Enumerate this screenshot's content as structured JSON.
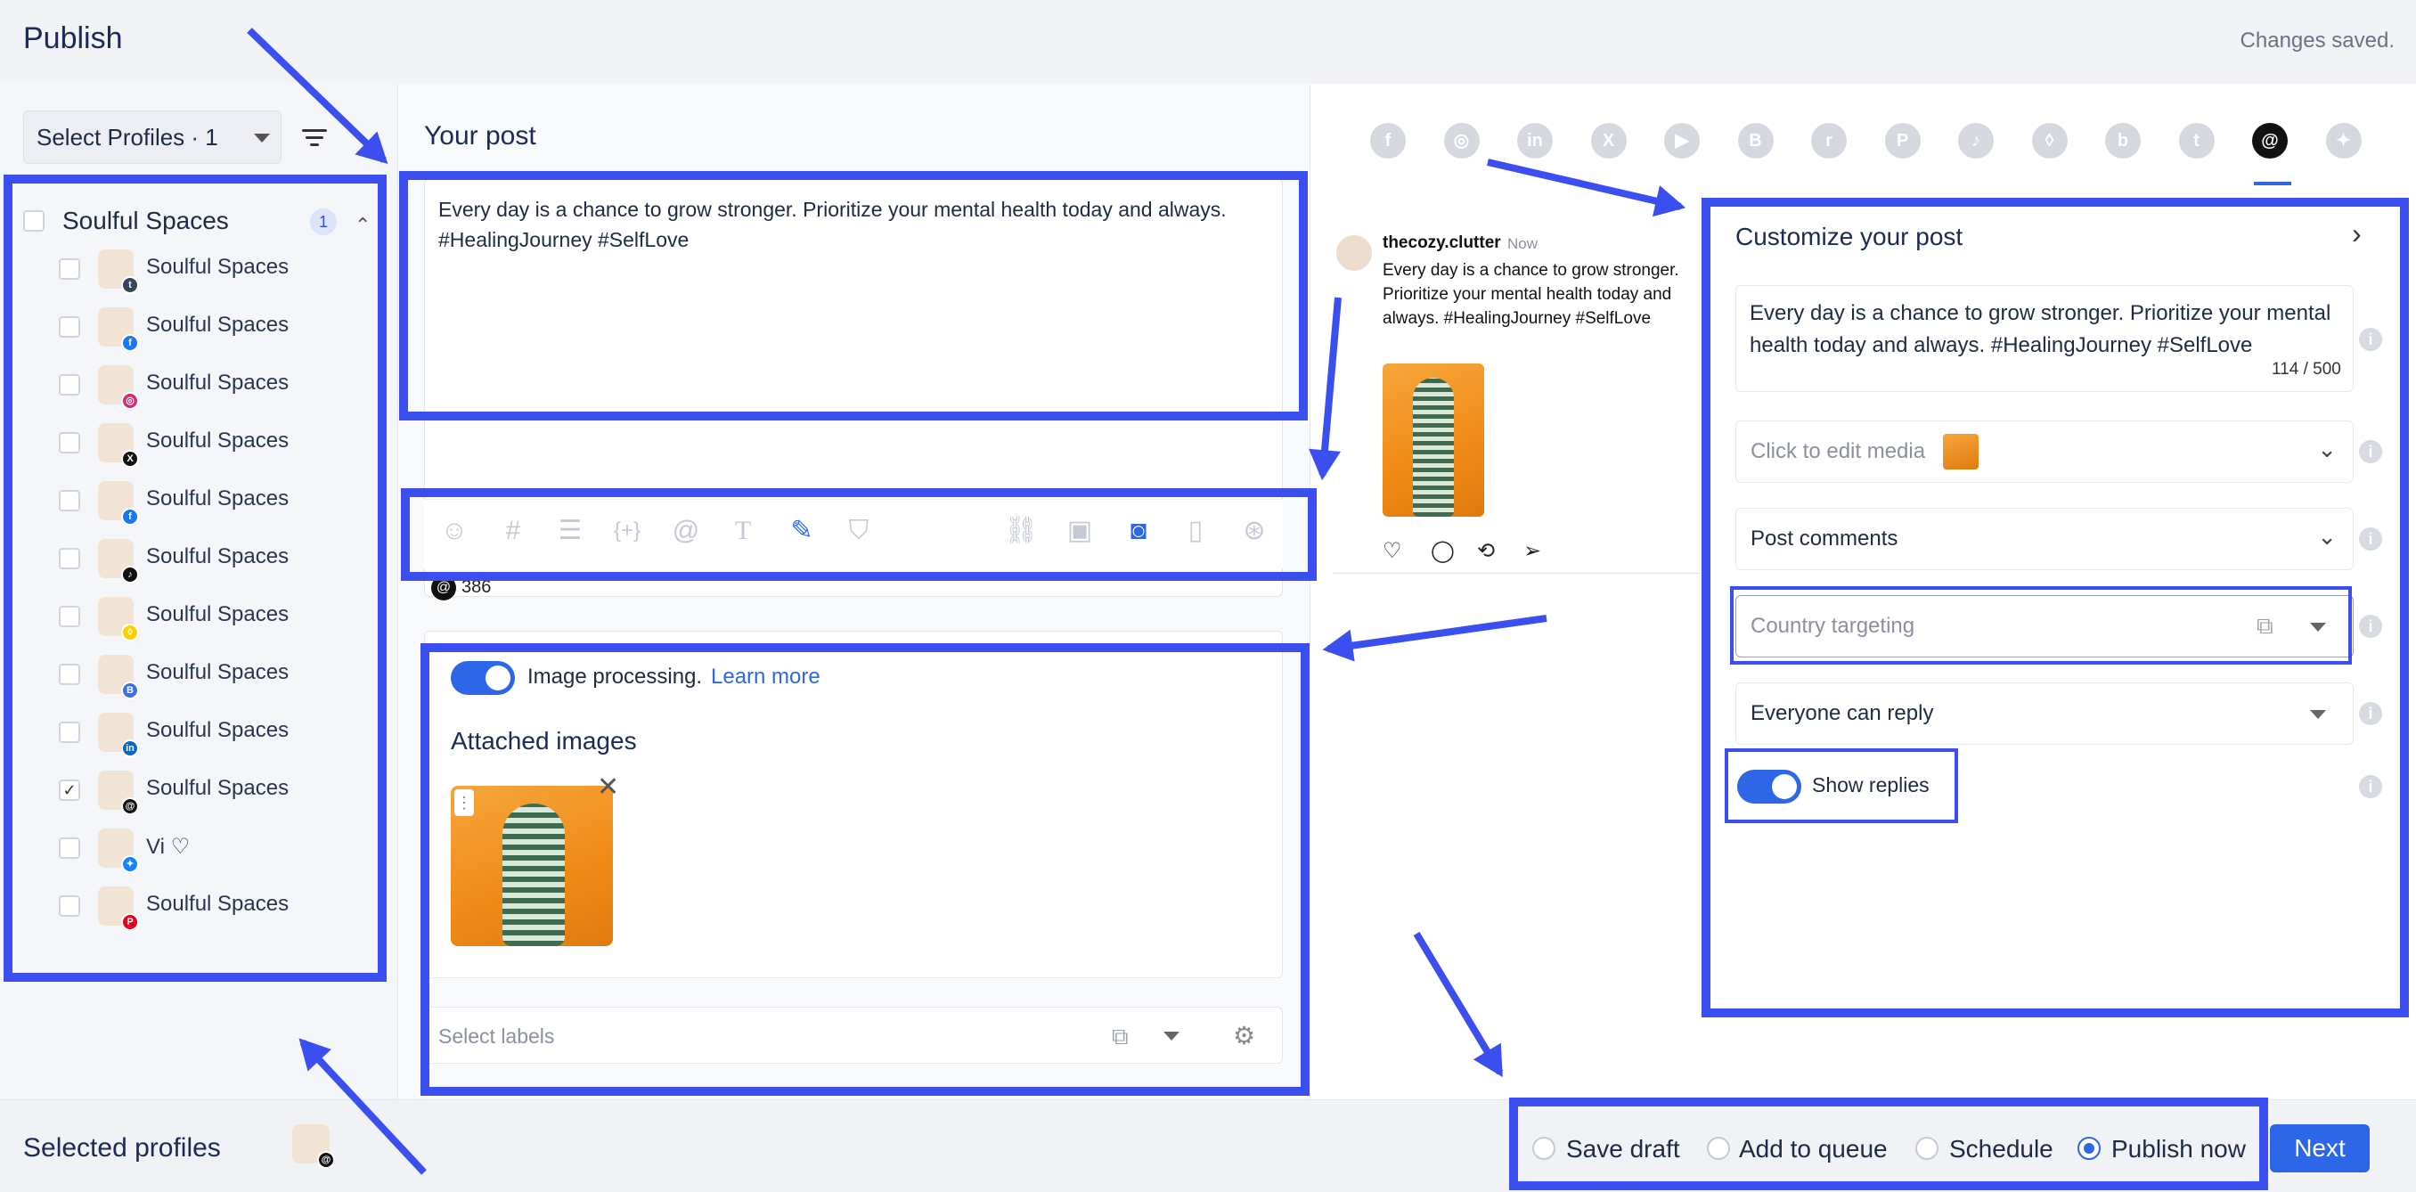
{
  "header": {
    "title": "Publish",
    "status": "Changes saved."
  },
  "profiles": {
    "select_label": "Select Profiles · 1",
    "group": {
      "name": "Soulful Spaces",
      "count": "1"
    },
    "items": [
      {
        "label": "Soulful Spaces",
        "network": "tumblr",
        "net_color": "#35465c",
        "checked": false
      },
      {
        "label": "Soulful Spaces",
        "network": "facebook",
        "net_color": "#1877f2",
        "checked": false
      },
      {
        "label": "Soulful Spaces",
        "network": "instagram",
        "net_color": "#d62976",
        "checked": false
      },
      {
        "label": "Soulful Spaces",
        "network": "x",
        "net_color": "#111111",
        "checked": false
      },
      {
        "label": "Soulful Spaces",
        "network": "facebook",
        "net_color": "#1877f2",
        "checked": false
      },
      {
        "label": "Soulful Spaces",
        "network": "tiktok",
        "net_color": "#111111",
        "checked": false
      },
      {
        "label": "Soulful Spaces",
        "network": "snapchat",
        "net_color": "#f7d100",
        "checked": false
      },
      {
        "label": "Soulful Spaces",
        "network": "google-business",
        "net_color": "#3b70e8",
        "checked": false
      },
      {
        "label": "Soulful Spaces",
        "network": "linkedin",
        "net_color": "#0a66c2",
        "checked": false
      },
      {
        "label": "Soulful Spaces",
        "network": "threads",
        "net_color": "#111111",
        "checked": true
      },
      {
        "label": "Vi ♡",
        "network": "bluesky",
        "net_color": "#1185fe",
        "checked": false
      },
      {
        "label": "Soulful Spaces",
        "network": "pinterest",
        "net_color": "#e60023",
        "checked": false
      }
    ]
  },
  "post": {
    "heading": "Your post",
    "text": "Every day is a chance to grow stronger. Prioritize your mental health today and always. #HealingJourney #SelfLove",
    "char_remaining": "386",
    "image_processing_label": "Image processing.",
    "learn_more": "Learn more",
    "attached_heading": "Attached images",
    "labels_placeholder": "Select labels"
  },
  "preview": {
    "username": "thecozy.clutter",
    "time": "Now",
    "text": "Every day is a chance to grow stronger. Prioritize your mental health today and always. #HealingJourney #SelfLove"
  },
  "customize": {
    "title": "Customize your post",
    "text": "Every day is a chance to grow stronger. Prioritize your mental health today and always. #HealingJourney #SelfLove",
    "count": "114 / 500",
    "media_label": "Click to edit media",
    "comments_label": "Post comments",
    "country_label": "Country targeting",
    "reply_label": "Everyone can reply",
    "show_replies": "Show replies"
  },
  "footer": {
    "selected_profiles": "Selected profiles",
    "options": [
      "Save draft",
      "Add to queue",
      "Schedule",
      "Publish now"
    ],
    "selected_option": "Publish now",
    "next": "Next"
  },
  "networks": [
    "facebook",
    "instagram",
    "linkedin",
    "x",
    "youtube",
    "google-business",
    "reddit",
    "pinterest",
    "tiktok",
    "snapchat",
    "blogger",
    "tumblr",
    "threads",
    "bluesky"
  ],
  "active_network": "threads",
  "accent_color": "#2d66e6",
  "annotation_color": "#3b4ef0"
}
